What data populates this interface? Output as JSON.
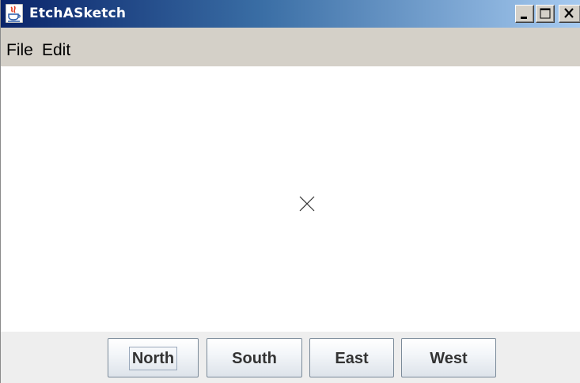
{
  "window": {
    "title": "EtchASketch"
  },
  "menubar": {
    "items": [
      {
        "label": "File"
      },
      {
        "label": "Edit"
      }
    ]
  },
  "canvas": {
    "cursor_icon": "x-crosshair-icon"
  },
  "buttons": {
    "north": "North",
    "south": "South",
    "east": "East",
    "west": "West"
  },
  "colors": {
    "titlebar_start": "#0a246a",
    "titlebar_end": "#a6caf0",
    "menubar": "#d4d0c8",
    "canvas": "#ffffff",
    "button_panel": "#eeeeee"
  }
}
